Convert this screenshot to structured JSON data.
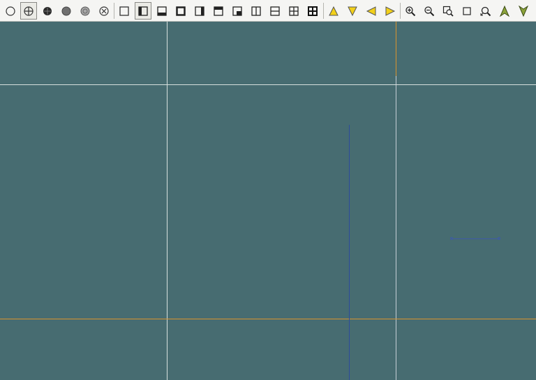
{
  "toolbar": {
    "buttons": [
      {
        "icon": "circle-outline-icon"
      },
      {
        "icon": "crosshair-circle-icon",
        "active": true
      },
      {
        "icon": "solid-dot-icon"
      },
      {
        "icon": "gray-sphere-icon"
      },
      {
        "icon": "light-sphere-icon"
      },
      {
        "icon": "x-circle-icon"
      },
      {
        "icon": "square-outline-icon"
      },
      {
        "icon": "left-half-square-icon",
        "active": true
      },
      {
        "icon": "bottom-half-square-icon"
      },
      {
        "icon": "thick-square-icon"
      },
      {
        "icon": "right-half-square-icon"
      },
      {
        "icon": "top-half-square-icon"
      },
      {
        "icon": "bottom-right-square-icon"
      },
      {
        "icon": "vertical-split-icon"
      },
      {
        "icon": "horizontal-split-icon"
      },
      {
        "icon": "quad-grid-icon"
      },
      {
        "icon": "quad-grid-bold-icon"
      },
      {
        "icon": "triangle-up-icon"
      },
      {
        "icon": "triangle-down-icon"
      },
      {
        "icon": "triangle-left-icon"
      },
      {
        "icon": "triangle-right-icon"
      },
      {
        "icon": "zoom-in-icon"
      },
      {
        "icon": "zoom-out-icon"
      },
      {
        "icon": "zoom-window-icon"
      },
      {
        "icon": "square-small-icon"
      },
      {
        "icon": "zoom-extents-icon"
      },
      {
        "icon": "arrow-up-green-icon"
      },
      {
        "icon": "arrow-down-green-icon"
      }
    ]
  },
  "colors": {
    "background": "#476c71",
    "toolbar": "#f5f5f3",
    "guide_white": "#d7e0de",
    "guide_orange": "#d9932d",
    "line_blue": "#2d4c9b",
    "triangle_yellow": "#f2d01a",
    "arrow_green": "#8ca43a"
  }
}
